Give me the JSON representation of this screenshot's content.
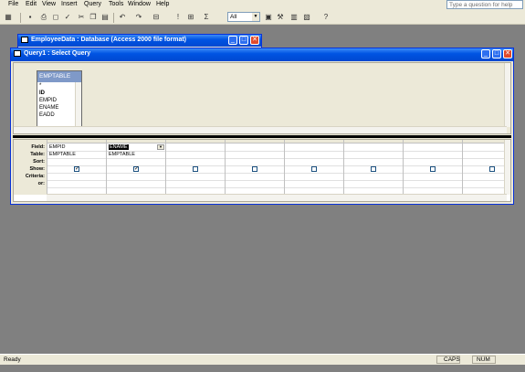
{
  "menu": {
    "items": [
      "File",
      "Edit",
      "View",
      "Insert",
      "Query",
      "Tools",
      "Window",
      "Help"
    ],
    "help_placeholder": "Type a question for help"
  },
  "toolbar": {
    "top_values": "All"
  },
  "db_window": {
    "title": "EmployeeData : Database (Access 2000 file format)"
  },
  "query_window": {
    "title": "Query1 : Select Query"
  },
  "table_box": {
    "name": "EMPTABLE",
    "fields": [
      "*",
      "ID",
      "EMPID",
      "ENAME",
      "EADD"
    ]
  },
  "grid": {
    "row_labels": [
      "Field:",
      "Table:",
      "Sort:",
      "Show:",
      "Criteria:",
      "or:"
    ],
    "columns": [
      {
        "field": "EMPID",
        "table": "EMPTABLE",
        "show": true
      },
      {
        "field": "ENAME",
        "table": "EMPTABLE",
        "show": true
      },
      {
        "field": "",
        "table": "",
        "show": false
      },
      {
        "field": "",
        "table": "",
        "show": false
      },
      {
        "field": "",
        "table": "",
        "show": false
      },
      {
        "field": "",
        "table": "",
        "show": false
      },
      {
        "field": "",
        "table": "",
        "show": false
      },
      {
        "field": "",
        "table": "",
        "show": false
      }
    ]
  },
  "status": {
    "left": "Ready",
    "caps": "CAPS",
    "num": "NUM"
  },
  "colors": {
    "titlebar": "#0054e3",
    "table_header": "#7f99c8",
    "background": "#808080"
  }
}
